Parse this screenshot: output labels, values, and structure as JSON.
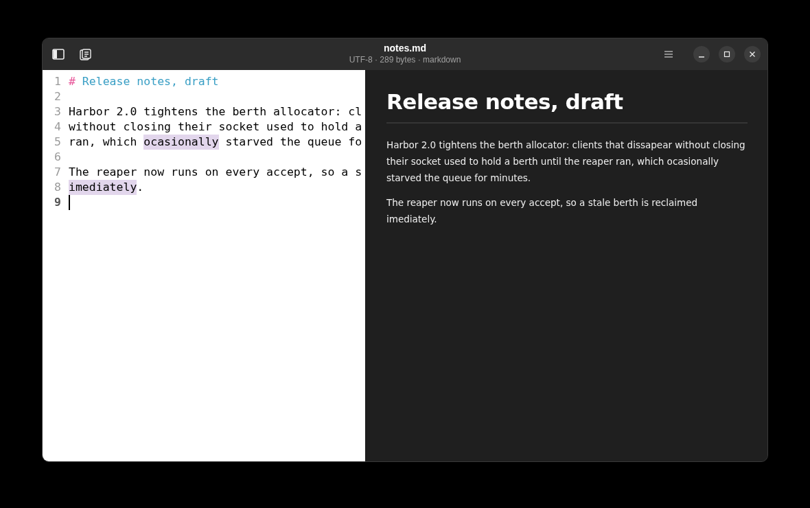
{
  "window": {
    "title": "notes.md",
    "subtitle": "UTF-8 · 289 bytes · markdown"
  },
  "editor": {
    "lines": [
      {
        "number": "1",
        "current": false,
        "segments": [
          {
            "text": "#",
            "kind": "heading-mark"
          },
          {
            "text": " Release notes, draft",
            "kind": "heading"
          }
        ]
      },
      {
        "number": "2",
        "current": false
      },
      {
        "number": "3",
        "current": false,
        "segments": [
          {
            "text": "Harbor 2.0 tightens the berth allocator: cl",
            "kind": "plain"
          }
        ]
      },
      {
        "number": "4",
        "current": false,
        "segments": [
          {
            "text": "without closing their socket used to hold a",
            "kind": "plain"
          }
        ]
      },
      {
        "number": "5",
        "current": false,
        "segments": [
          {
            "text": "ran, which ",
            "kind": "plain"
          },
          {
            "text": "ocasionally",
            "kind": "misspelled"
          },
          {
            "text": " starved the queue fo",
            "kind": "plain"
          }
        ]
      },
      {
        "number": "6",
        "current": false
      },
      {
        "number": "7",
        "current": false,
        "segments": [
          {
            "text": "The reaper now runs on every accept, so a s",
            "kind": "plain"
          }
        ]
      },
      {
        "number": "8",
        "current": false,
        "segments": [
          {
            "text": "imediately",
            "kind": "misspelled"
          },
          {
            "text": ".",
            "kind": "plain"
          }
        ]
      },
      {
        "number": "9",
        "current": true
      }
    ]
  },
  "preview": {
    "heading": "Release notes, draft",
    "paragraphs": [
      "Harbor 2.0 tightens the berth allocator: clients that dissapear without closing their socket used to hold a berth until the reaper ran, which ocasionally starved the queue for minutes.",
      "The reaper now runs on every accept, so a stale berth is reclaimed imediately."
    ]
  }
}
